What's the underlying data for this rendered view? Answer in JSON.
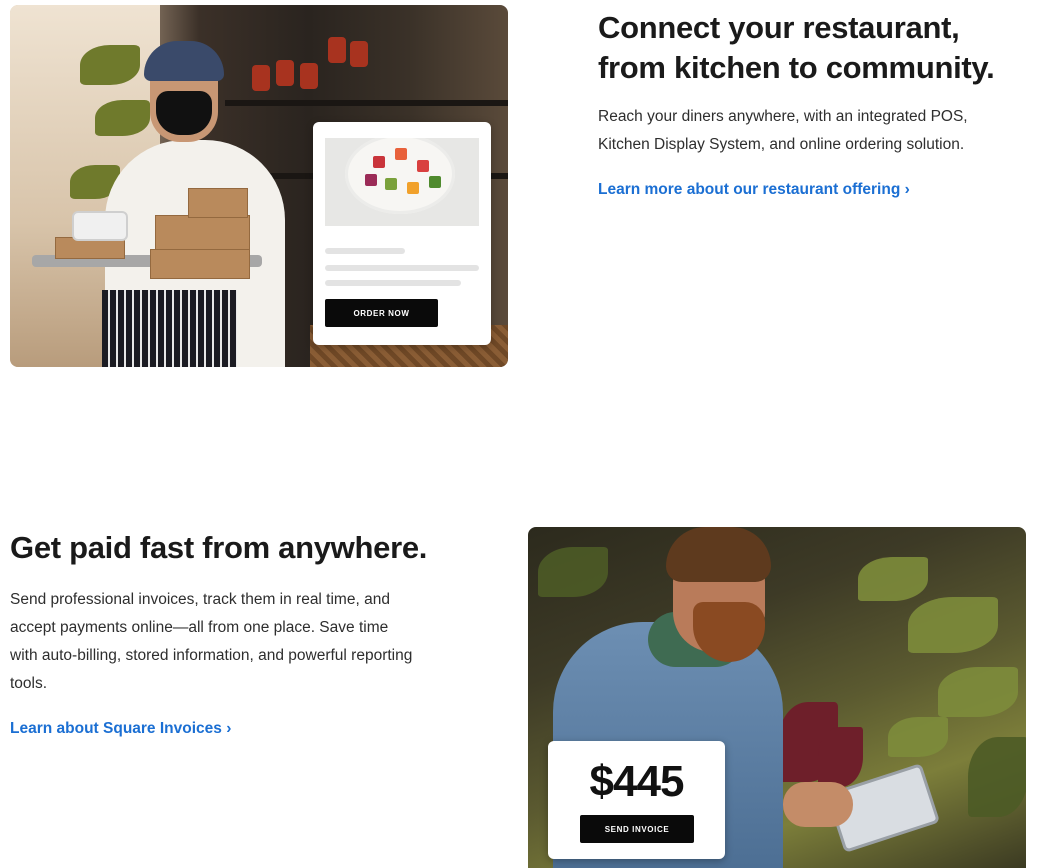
{
  "restaurant_section": {
    "heading_line1": "Connect your restaurant,",
    "heading_line2": "from kitchen to community.",
    "body": "Reach your diners anywhere, with an integrated POS, Kitchen Display System, and online ordering solution.",
    "link_label": "Learn more about our restaurant offering ›",
    "card": {
      "button_label": "ORDER NOW"
    }
  },
  "invoices_section": {
    "heading": "Get paid fast from anywhere.",
    "body": "Send professional invoices, track them in real time, and accept payments online—all from one place. Save time with auto-billing, stored information, and powerful reporting tools.",
    "link_label": "Learn about Square Invoices ›",
    "card": {
      "amount": "$445",
      "button_label": "SEND INVOICE"
    }
  },
  "colors": {
    "link": "#1b6fd3",
    "button": "#0a0a0a",
    "heading": "#1a1a1a"
  }
}
